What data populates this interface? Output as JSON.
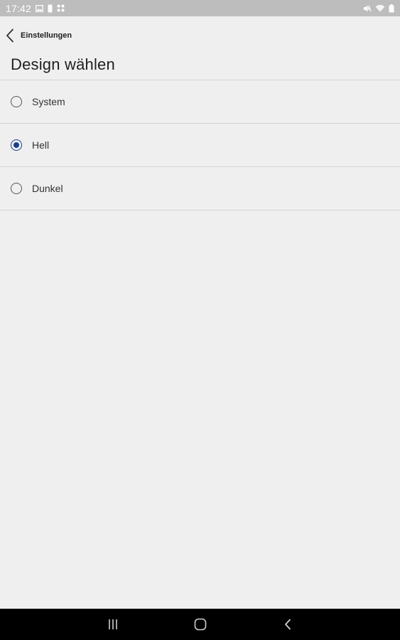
{
  "status_bar": {
    "time": "17:42",
    "left_icons": [
      "gallery-icon",
      "lock-icon",
      "apps-grid-icon"
    ],
    "right_icons": [
      "mute-icon",
      "wifi-icon",
      "battery-icon"
    ]
  },
  "header": {
    "back_label": "Einstellungen",
    "title": "Design wählen"
  },
  "options": [
    {
      "label": "System",
      "selected": false
    },
    {
      "label": "Hell",
      "selected": true
    },
    {
      "label": "Dunkel",
      "selected": false
    }
  ],
  "nav_bar": {
    "buttons": [
      "recent-apps-icon",
      "home-icon",
      "back-icon"
    ]
  },
  "colors": {
    "accent": "#1a3f8f",
    "background": "#efefef",
    "status_bar": "#bdbdbd",
    "nav_bar": "#000000",
    "divider": "#d4d4d4"
  }
}
